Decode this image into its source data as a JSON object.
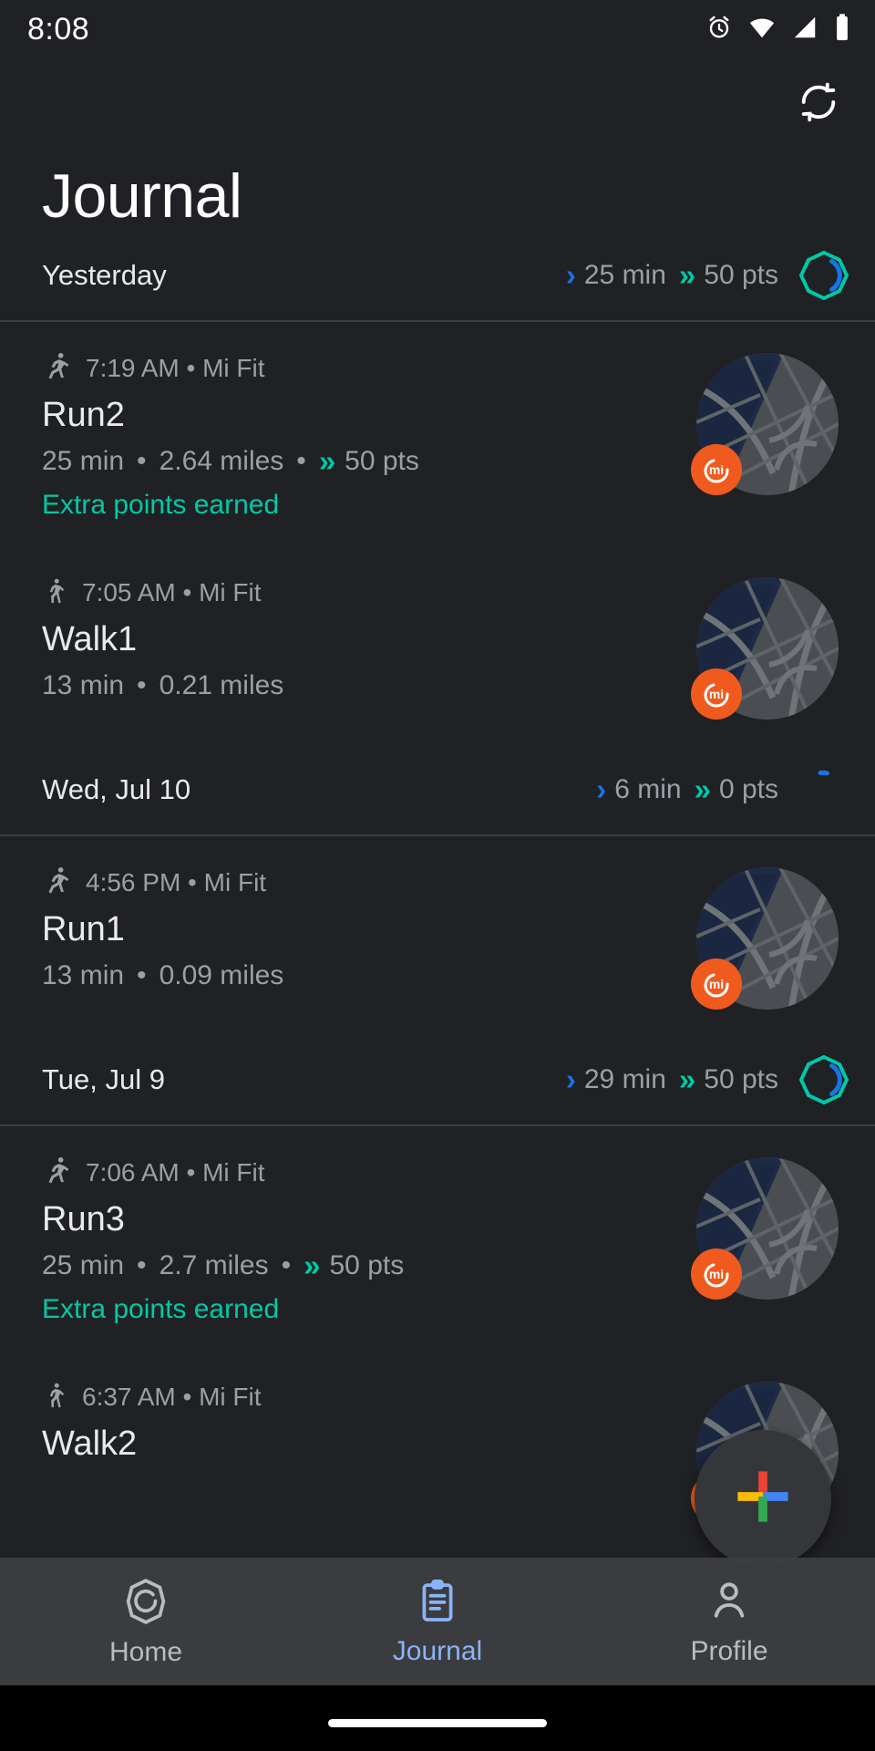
{
  "status_bar": {
    "time": "8:08",
    "icons": [
      "alarm-icon",
      "wifi-icon",
      "signal-icon",
      "battery-icon"
    ]
  },
  "header": {
    "title": "Journal",
    "sync_icon": "sync-icon"
  },
  "colors": {
    "background": "#202124",
    "accent_blue": "#1a73e8",
    "accent_green": "#00c9a7",
    "nav_active": "#8ab4f8",
    "mi_badge": "#f05a1e",
    "text_primary": "#e8eaed",
    "text_secondary": "#9aa0a6"
  },
  "sections": [
    {
      "day_label": "Yesterday",
      "duration": "25 min",
      "points": "50 pts",
      "ring": "full",
      "entries": [
        {
          "icon": "running-icon",
          "meta": "7:19 AM • Mi Fit",
          "title": "Run2",
          "duration": "25 min",
          "distance": "2.64 miles",
          "points": "50 pts",
          "has_points": true,
          "extra": "Extra points earned",
          "thumb": "map-thumbnail",
          "badge": "mi-fit-badge"
        },
        {
          "icon": "walking-icon",
          "meta": "7:05 AM • Mi Fit",
          "title": "Walk1",
          "duration": "13 min",
          "distance": "0.21 miles",
          "points": "",
          "has_points": false,
          "extra": "",
          "thumb": "map-thumbnail",
          "badge": "mi-fit-badge"
        }
      ]
    },
    {
      "day_label": "Wed, Jul 10",
      "duration": "6 min",
      "points": "0 pts",
      "ring": "partial",
      "entries": [
        {
          "icon": "running-icon",
          "meta": "4:56 PM • Mi Fit",
          "title": "Run1",
          "duration": "13 min",
          "distance": "0.09 miles",
          "points": "",
          "has_points": false,
          "extra": "",
          "thumb": "map-thumbnail",
          "badge": "mi-fit-badge"
        }
      ]
    },
    {
      "day_label": "Tue, Jul 9",
      "duration": "29 min",
      "points": "50 pts",
      "ring": "full",
      "entries": [
        {
          "icon": "running-icon",
          "meta": "7:06 AM • Mi Fit",
          "title": "Run3",
          "duration": "25 min",
          "distance": "2.7 miles",
          "points": "50 pts",
          "has_points": true,
          "extra": "Extra points earned",
          "thumb": "map-thumbnail",
          "badge": "mi-fit-badge"
        },
        {
          "icon": "walking-icon",
          "meta": "6:37 AM • Mi Fit",
          "title": "Walk2",
          "duration": "",
          "distance": "",
          "points": "",
          "has_points": false,
          "extra": "",
          "thumb": "map-thumbnail",
          "badge": "mi-fit-badge"
        }
      ]
    }
  ],
  "fab": {
    "icon": "google-plus-add-icon"
  },
  "bottom_nav": {
    "items": [
      {
        "label": "Home",
        "icon": "fit-rings-icon",
        "active": false
      },
      {
        "label": "Journal",
        "icon": "clipboard-icon",
        "active": true
      },
      {
        "label": "Profile",
        "icon": "person-icon",
        "active": false
      }
    ]
  }
}
